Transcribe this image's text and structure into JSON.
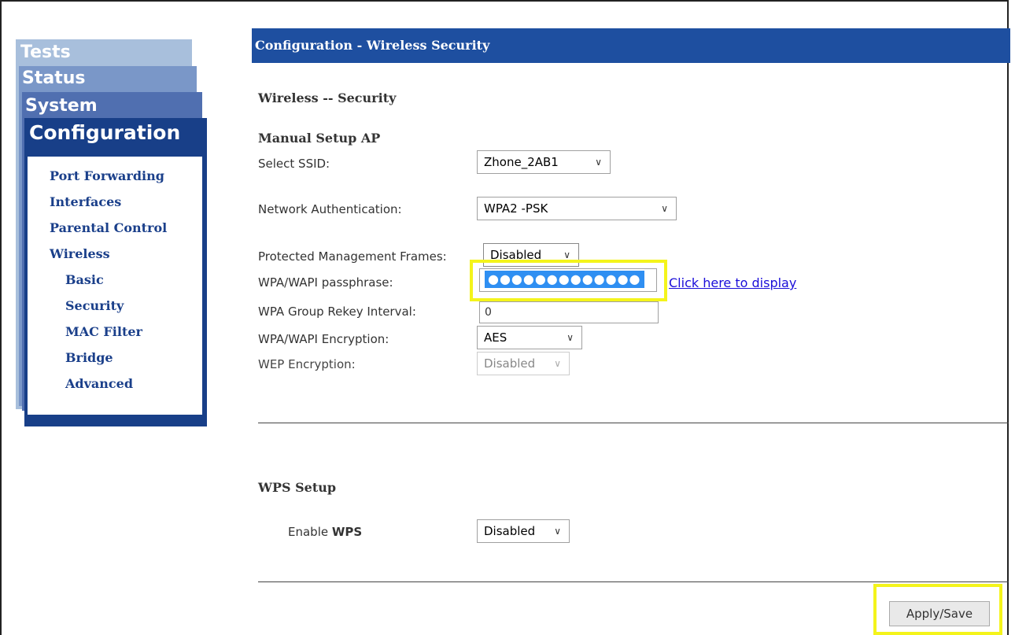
{
  "sidebar": {
    "tabs": [
      "Tests",
      "Status",
      "System",
      "Configuration"
    ],
    "menu": [
      {
        "label": "Port Forwarding"
      },
      {
        "label": "Interfaces"
      },
      {
        "label": "Parental Control"
      },
      {
        "label": "Wireless"
      },
      {
        "label": "Basic"
      },
      {
        "label": "Security"
      },
      {
        "label": "MAC Filter"
      },
      {
        "label": "Bridge"
      },
      {
        "label": "Advanced"
      }
    ]
  },
  "page": {
    "header": "Configuration - Wireless Security",
    "section_title": "Wireless -- Security",
    "manual_setup_title": "Manual Setup AP"
  },
  "form": {
    "ssid_label": "Select SSID:",
    "ssid_value": "Zhone_2AB1",
    "auth_label": "Network Authentication:",
    "auth_value": "WPA2 -PSK",
    "pmf_label": "Protected Management Frames:",
    "pmf_value": "Disabled",
    "pass_label": "WPA/WAPI passphrase:",
    "pass_value": "●●●●●●●●●●●●●",
    "display_link": "Click here to display",
    "rekey_label": "WPA Group Rekey Interval:",
    "rekey_value": "0",
    "enc_label": "WPA/WAPI Encryption:",
    "enc_value": "AES",
    "wep_label": "WEP Encryption:",
    "wep_value": "Disabled"
  },
  "wps": {
    "title": "WPS Setup",
    "enable_prefix": "Enable ",
    "enable_bold": "WPS",
    "value": "Disabled"
  },
  "actions": {
    "apply_label": "Apply/Save"
  },
  "icons": {
    "dropdown": "chevron-down-icon"
  },
  "colors": {
    "header_bg": "#1e4fa0",
    "highlight": "#f4f41b",
    "link": "#1a0dd9"
  }
}
